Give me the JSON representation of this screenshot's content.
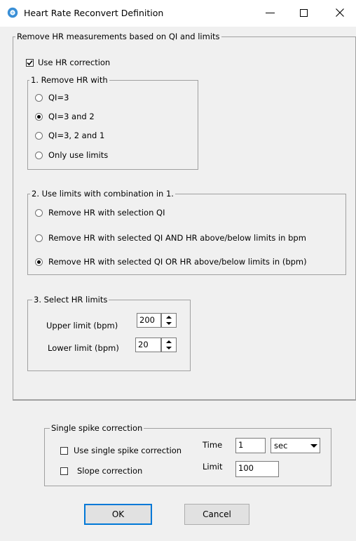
{
  "window": {
    "title": "Heart Rate Reconvert Definition"
  },
  "main_group": {
    "legend": "Remove  HR measurements based on QI and limits",
    "use_hr_correction": {
      "label": "Use HR correction",
      "checked": true
    },
    "remove_hr": {
      "legend": "1. Remove HR with",
      "options": [
        {
          "label": "QI=3",
          "selected": false
        },
        {
          "label": "QI=3 and 2",
          "selected": true
        },
        {
          "label": "QI=3, 2 and 1",
          "selected": false
        },
        {
          "label": "Only use limits",
          "selected": false
        }
      ]
    },
    "use_limits": {
      "legend": "2. Use limits with combination in 1.",
      "options": [
        {
          "label": "Remove HR with selection QI",
          "selected": false
        },
        {
          "label": "Remove HR with selected QI AND HR above/below limits in bpm",
          "selected": false
        },
        {
          "label": "Remove HR with selected QI OR HR above/below limits in (bpm)",
          "selected": true
        }
      ]
    },
    "hr_limits": {
      "legend": "3. Select HR limits",
      "upper_label": "Upper limit (bpm)",
      "upper_value": "200",
      "lower_label": "Lower limit (bpm)",
      "lower_value": "20"
    }
  },
  "spike_group": {
    "legend": "Single spike correction",
    "use_single_spike": {
      "label": "Use single spike correction",
      "checked": false
    },
    "slope_correction": {
      "label": "Slope correction",
      "checked": false
    },
    "time_label": "Time",
    "time_value": "1",
    "time_unit": "sec",
    "limit_label": "Limit",
    "limit_value": "100"
  },
  "buttons": {
    "ok": "OK",
    "cancel": "Cancel"
  },
  "colors": {
    "icon_blue": "#3a8fd6",
    "default_border": "#0078d7",
    "groupbox_border": "#a0a0a0"
  }
}
